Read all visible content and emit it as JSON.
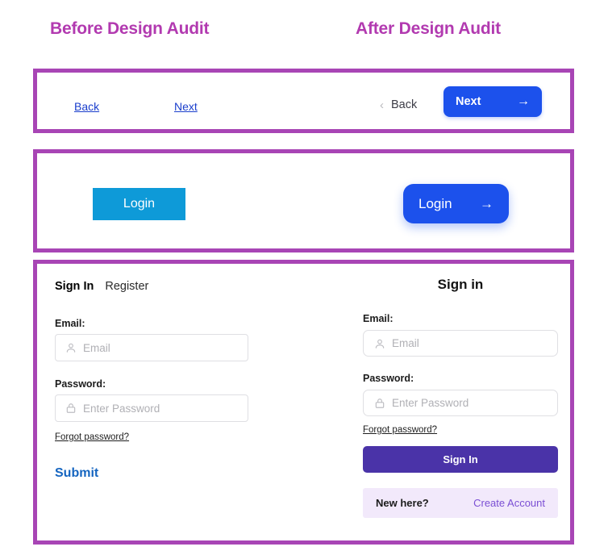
{
  "headings": {
    "before": "Before Design Audit",
    "after": "After Design Audit"
  },
  "colors": {
    "panel_border": "#a845b5",
    "heading_purple": "#b23ab0",
    "primary_blue": "#1c51ec",
    "old_cyan": "#0e9ad8",
    "old_link_blue": "#1a3ecc",
    "submit_blue": "#1565c0",
    "signin_purple": "#4a33a8",
    "newhere_bg": "#f2e9fb",
    "create_account_purple": "#7b4fd4"
  },
  "nav_panel": {
    "before": {
      "back_link": "Back",
      "next_link": "Next"
    },
    "after": {
      "back_label": "Back",
      "back_chevron": "‹",
      "next_label": "Next",
      "next_arrow": "→"
    }
  },
  "login_panel": {
    "before": {
      "login_label": "Login"
    },
    "after": {
      "login_label": "Login",
      "arrow": "→"
    }
  },
  "form_panel": {
    "before": {
      "tab_signin": "Sign In",
      "tab_register": "Register",
      "email_label": "Email:",
      "email_placeholder": "Email",
      "password_label": "Password:",
      "password_placeholder": "Enter Password",
      "forgot_password": "Forgot password?",
      "submit_label": "Submit"
    },
    "after": {
      "title": "Sign in",
      "email_label": "Email:",
      "email_placeholder": "Email",
      "password_label": "Password:",
      "password_placeholder": "Enter Password",
      "forgot_password": "Forgot password?",
      "signin_button": "Sign In",
      "new_here": "New here?",
      "create_account": "Create Account"
    }
  }
}
